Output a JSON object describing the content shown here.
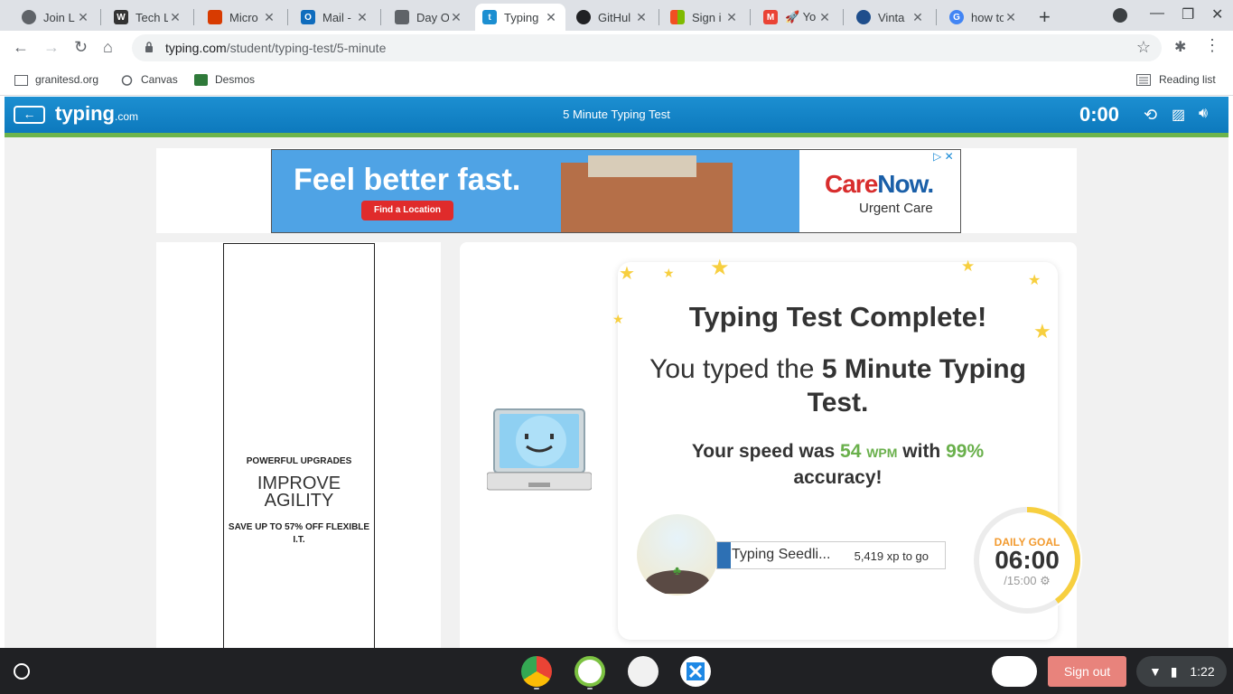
{
  "browser": {
    "tabs": [
      {
        "title": "Join L",
        "icon": "globe-icon",
        "color": "#5f6368"
      },
      {
        "title": "Tech L",
        "icon": "w-icon",
        "color": "#333333"
      },
      {
        "title": "Micro",
        "icon": "office-icon",
        "color": "#d83b01"
      },
      {
        "title": "Mail - ",
        "icon": "outlook-icon",
        "color": "#0f6cbd"
      },
      {
        "title": "Day O",
        "icon": "canvas-icon",
        "color": "#5f6368"
      },
      {
        "title": "Typing",
        "icon": "typing-icon",
        "color": "#1c8fd1"
      },
      {
        "title": "GitHul",
        "icon": "github-icon",
        "color": "#202124"
      },
      {
        "title": "Sign i",
        "icon": "microsoft-icon",
        "color": "#f25022"
      },
      {
        "title": "🚀 Yo",
        "icon": "gmail-icon",
        "color": "#ea4335"
      },
      {
        "title": "Vinta",
        "icon": "ksl-icon",
        "color": "#1f4e8c"
      },
      {
        "title": "how to",
        "icon": "google-icon",
        "color": "#4285f4"
      }
    ],
    "url_domain": "typing.com",
    "url_path": "/student/typing-test/5-minute",
    "bookmarks": [
      {
        "label": "granitesd.org"
      },
      {
        "label": "Canvas"
      },
      {
        "label": "Desmos"
      }
    ],
    "reading_list": "Reading list"
  },
  "page": {
    "logo_main": "typing",
    "logo_suffix": ".com",
    "title": "5 Minute Typing Test",
    "timer": "0:00",
    "ad_banner": {
      "headline": "Feel better fast.",
      "cta": "Find a Location",
      "brand_care": "Care",
      "brand_now": "Now.",
      "brand_sub": "Urgent Care"
    },
    "side_ad": {
      "line1": "POWERFUL UPGRADES",
      "line2": "IMPROVE AGILITY",
      "line3": "SAVE UP TO 57% OFF FLEXIBLE I.T."
    },
    "result": {
      "heading": "Typing Test Complete!",
      "typed_prefix": "You typed the ",
      "typed_test": "5 Minute Typing Test.",
      "speed_prefix": "Your speed was ",
      "wpm_value": "54",
      "wpm_unit": "WPM",
      "speed_mid": " with ",
      "accuracy": "99%",
      "speed_suffix": "accuracy!"
    },
    "xp": {
      "level_name": "Typing Seedli...",
      "to_go": "5,419 xp to go",
      "progress_fraction": 0.06
    },
    "daily_goal": {
      "label": "DAILY GOAL",
      "time": "06:00",
      "of": "/15:00",
      "progress_fraction": 0.4
    }
  },
  "shelf": {
    "signout": "Sign out",
    "clock": "1:22",
    "apps": [
      "chrome-icon",
      "timer-app-icon",
      "dots-app-icon",
      "x-app-icon"
    ]
  },
  "colors": {
    "header_blue": "#1c8fd1",
    "accent_green": "#6ab04c",
    "goal_orange": "#f29a2e",
    "star_yellow": "#f7cf3f"
  }
}
